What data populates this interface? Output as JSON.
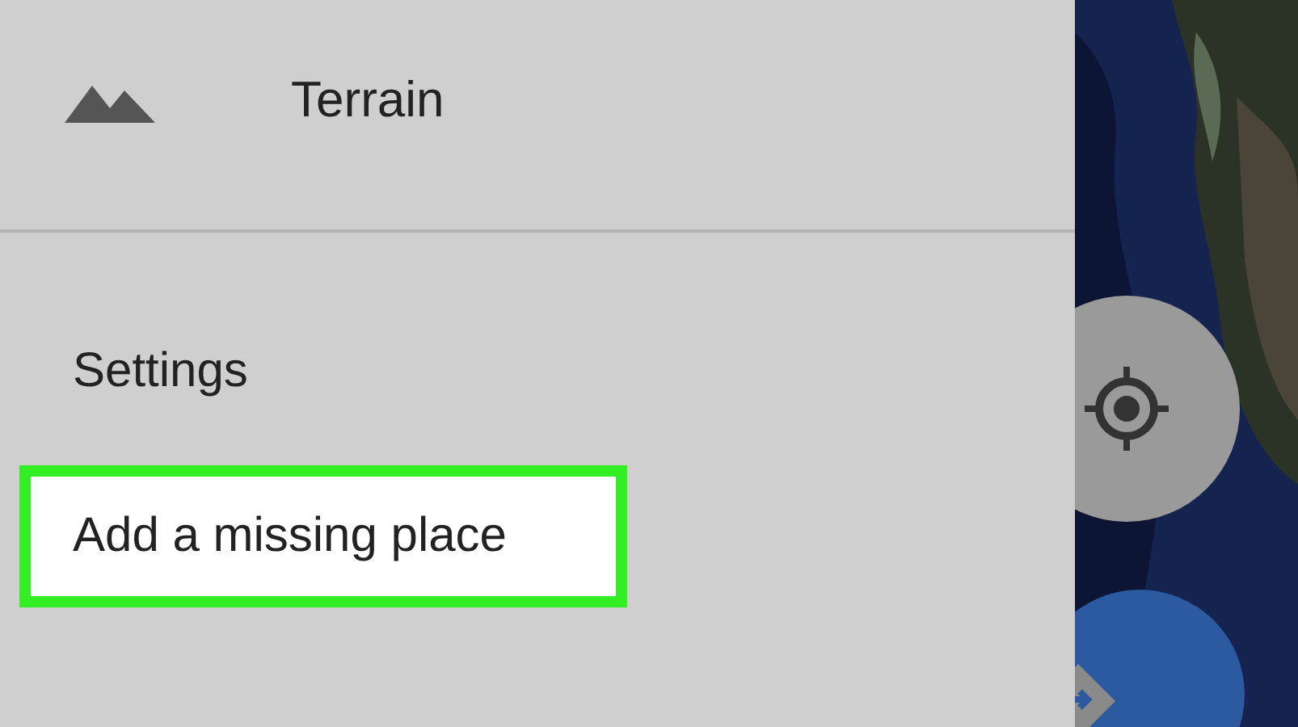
{
  "drawer": {
    "map_types": [
      {
        "label": "Terrain"
      }
    ],
    "items": [
      {
        "label": "Settings",
        "highlighted": false
      },
      {
        "label": "Add a missing place",
        "highlighted": true
      }
    ]
  }
}
